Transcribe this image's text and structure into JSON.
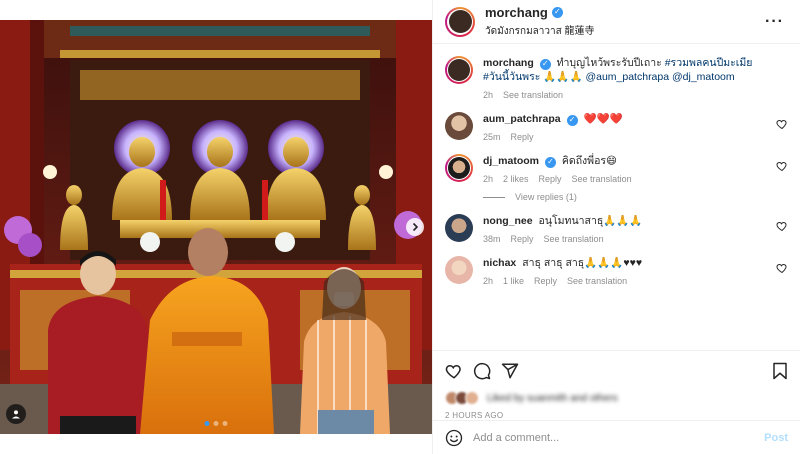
{
  "post": {
    "author": "morchang",
    "location": "วัดมังกรกมลาวาส 龍蓮寺"
  },
  "caption": {
    "username": "morchang",
    "text_1": "ทำบุญไหว้พระรับปีเถาะ",
    "hashtag_1": "#รวมพลคนปีมะเมีย",
    "hashtag_2": "#วันนี้วันพระ",
    "emoji": "🙏🙏🙏",
    "mention_1": "@aum_patchrapa",
    "mention_2": "@dj_matoom",
    "time": "2h",
    "see_translation": "See translation"
  },
  "comments": [
    {
      "username": "aum_patchrapa",
      "verified": true,
      "text": "❤️❤️❤️",
      "time": "25m",
      "likes": "",
      "reply": "Reply",
      "translation": ""
    },
    {
      "username": "dj_matoom",
      "verified": true,
      "text": "คิดถึงพี่อร😄",
      "time": "2h",
      "likes": "2 likes",
      "reply": "Reply",
      "translation": "See translation"
    },
    {
      "username": "nong_nee",
      "verified": false,
      "text": "อนุโมทนาสาธุ🙏🙏🙏",
      "time": "38m",
      "likes": "",
      "reply": "Reply",
      "translation": "See translation"
    },
    {
      "username": "nichax",
      "verified": false,
      "text": "สาธุ สาธุ สาธุ🙏🙏🙏♥♥♥",
      "time": "2h",
      "likes": "1 like",
      "reply": "Reply",
      "translation": "See translation"
    }
  ],
  "view_replies": "View replies (1)",
  "likes_text": "Liked by suanmith and others",
  "time_ago": "2 HOURS AGO",
  "add_comment": {
    "placeholder": "Add a comment...",
    "post_label": "Post"
  },
  "carousel": {
    "total": 3,
    "active": 1
  },
  "icons": {
    "more": "more-options-icon",
    "heart": "heart-icon",
    "comment": "comment-icon",
    "share": "share-icon",
    "save": "bookmark-icon",
    "emoji": "emoji-icon",
    "next": "chevron-right-icon",
    "tag": "user-tag-icon"
  },
  "colors": {
    "link": "#00376b",
    "accent": "#3897f0",
    "muted": "#8e8e8e",
    "heart": "#ed4956"
  }
}
